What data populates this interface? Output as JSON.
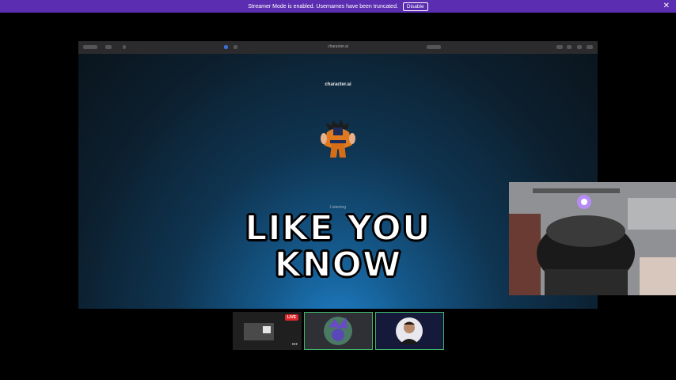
{
  "banner": {
    "message": "Streamer Mode is enabled. Usernames have been truncated.",
    "disable_label": "Disable",
    "close_icon": "close-icon"
  },
  "browser": {
    "url": "character.ai"
  },
  "page": {
    "brand": "character.ai",
    "status": "Listening"
  },
  "caption": {
    "line1": "LIKE YOU",
    "line2": "KNOW"
  },
  "participants": {
    "live_badge": "LIVE",
    "more_label": "•••"
  }
}
